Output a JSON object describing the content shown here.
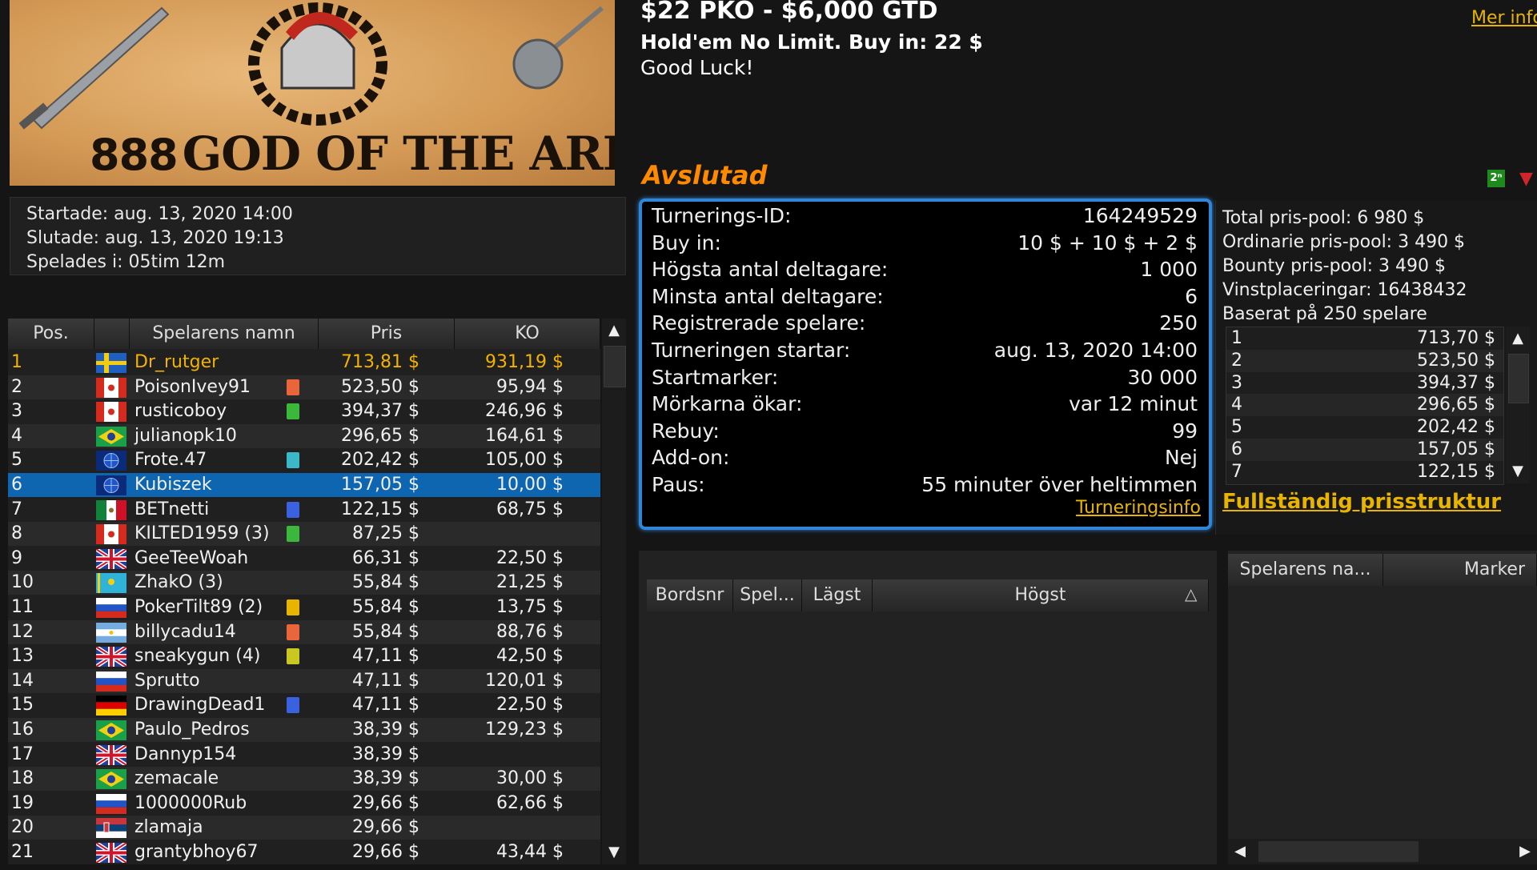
{
  "banner": {
    "logo_888": "888",
    "logo_text": "GOD OF THE ARENA"
  },
  "dates": {
    "started": "Startade: aug. 13, 2020 14:00",
    "ended": "Slutade: aug. 13, 2020 19:13",
    "played": "Spelades i: 05tim 12m"
  },
  "header": {
    "title": "$22 PKO - $6,000 GTD",
    "subtitle": "Hold'em No Limit. Buy in: 22 $",
    "greeting": "Good Luck!",
    "more_info": "Mer info",
    "status": "Avslutad",
    "badge_2n": "2ⁿ"
  },
  "players_table": {
    "columns": [
      "Pos.",
      "",
      "Spelarens namn",
      "Pris",
      "KO"
    ],
    "rows": [
      {
        "pos": "1",
        "flag": "sweden",
        "name": "Dr_rutger",
        "note": "",
        "prize": "713,81 $",
        "ko": "931,19 $"
      },
      {
        "pos": "2",
        "flag": "canada",
        "name": "PoisonIvey91",
        "note": "#e8663a",
        "prize": "523,50 $",
        "ko": "95,94 $"
      },
      {
        "pos": "3",
        "flag": "canada",
        "name": "rusticoboy",
        "note": "#3bb83b",
        "prize": "394,37 $",
        "ko": "246,96 $"
      },
      {
        "pos": "4",
        "flag": "brazil",
        "name": "julianopk10",
        "note": "",
        "prize": "296,65 $",
        "ko": "164,61 $"
      },
      {
        "pos": "5",
        "flag": "globe",
        "name": "Frote.47",
        "note": "#3ab8c8",
        "prize": "202,42 $",
        "ko": "105,00 $"
      },
      {
        "pos": "6",
        "flag": "globe",
        "name": "Kubiszek",
        "note": "",
        "prize": "157,05 $",
        "ko": "10,00 $"
      },
      {
        "pos": "7",
        "flag": "mexico",
        "name": "BETnetti",
        "note": "#3a62e0",
        "prize": "122,15 $",
        "ko": "68,75 $"
      },
      {
        "pos": "8",
        "flag": "canada",
        "name": "KILTED1959 (3)",
        "note": "#3bb83b",
        "prize": "87,25 $",
        "ko": ""
      },
      {
        "pos": "9",
        "flag": "uk",
        "name": "GeeTeeWoah",
        "note": "",
        "prize": "66,31 $",
        "ko": "22,50 $"
      },
      {
        "pos": "10",
        "flag": "kazakhstan",
        "name": "ZhakO (3)",
        "note": "",
        "prize": "55,84 $",
        "ko": "21,25 $"
      },
      {
        "pos": "11",
        "flag": "russia",
        "name": "PokerTilt89 (2)",
        "note": "#e8b400",
        "prize": "55,84 $",
        "ko": "13,75 $"
      },
      {
        "pos": "12",
        "flag": "argentina",
        "name": "billycadu14",
        "note": "#e8663a",
        "prize": "55,84 $",
        "ko": "88,76 $"
      },
      {
        "pos": "13",
        "flag": "uk",
        "name": "sneakygun (4)",
        "note": "#c8c820",
        "prize": "47,11 $",
        "ko": "42,50 $"
      },
      {
        "pos": "14",
        "flag": "russia",
        "name": "Sprutto",
        "note": "",
        "prize": "47,11 $",
        "ko": "120,01 $"
      },
      {
        "pos": "15",
        "flag": "germany",
        "name": "DrawingDead1",
        "note": "#3a62e0",
        "prize": "47,11 $",
        "ko": "22,50 $"
      },
      {
        "pos": "16",
        "flag": "brazil",
        "name": "Paulo_Pedros",
        "note": "",
        "prize": "38,39 $",
        "ko": "129,23 $"
      },
      {
        "pos": "17",
        "flag": "uk",
        "name": "Dannyp154",
        "note": "",
        "prize": "38,39 $",
        "ko": ""
      },
      {
        "pos": "18",
        "flag": "brazil",
        "name": "zemacale",
        "note": "",
        "prize": "38,39 $",
        "ko": "30,00 $"
      },
      {
        "pos": "19",
        "flag": "russia",
        "name": "1000000Rub",
        "note": "",
        "prize": "29,66 $",
        "ko": "62,66 $"
      },
      {
        "pos": "20",
        "flag": "serbia",
        "name": "zlamaja",
        "note": "",
        "prize": "29,66 $",
        "ko": ""
      },
      {
        "pos": "21",
        "flag": "uk",
        "name": "grantybhoy67",
        "note": "",
        "prize": "29,66 $",
        "ko": "43,44 $"
      }
    ],
    "selected_row": "6"
  },
  "tournament_info": {
    "rows": [
      {
        "label": "Turnerings-ID:",
        "value": "164249529"
      },
      {
        "label": "Buy in:",
        "value": "10 $ + 10 $ + 2 $"
      },
      {
        "label": "Högsta antal deltagare:",
        "value": "1 000"
      },
      {
        "label": "Minsta antal deltagare:",
        "value": "6"
      },
      {
        "label": "Registrerade spelare:",
        "value": "250"
      },
      {
        "label": "Turneringen startar:",
        "value": "aug. 13, 2020 14:00"
      },
      {
        "label": "Startmarker:",
        "value": "30 000"
      },
      {
        "label": "Mörkarna ökar:",
        "value": "var 12 minut"
      },
      {
        "label": "Rebuy:",
        "value": "99"
      },
      {
        "label": "Add-on:",
        "value": "Nej"
      },
      {
        "label": "Paus:",
        "value": "55 minuter över heltimmen"
      }
    ],
    "link": "Turneringsinfo"
  },
  "prize_pool": {
    "total": "Total pris-pool: 6 980 $",
    "ordinary": "Ordinarie pris-pool: 3 490 $",
    "bounty": "Bounty pris-pool: 3 490 $",
    "placings": "Vinstplaceringar: 16438432",
    "based_on": "Baserat på 250 spelare",
    "list": [
      {
        "place": "1",
        "amount": "713,70 $"
      },
      {
        "place": "2",
        "amount": "523,50 $"
      },
      {
        "place": "3",
        "amount": "394,37 $"
      },
      {
        "place": "4",
        "amount": "296,65 $"
      },
      {
        "place": "5",
        "amount": "202,42 $"
      },
      {
        "place": "6",
        "amount": "157,05 $"
      },
      {
        "place": "7",
        "amount": "122,15 $"
      }
    ],
    "full_structure_link": "Fullständig prisstruktur"
  },
  "tables_panel": {
    "columns": [
      "Bordsnr",
      "Spel...",
      "Lägst",
      "Högst"
    ]
  },
  "table_players_panel": {
    "columns": [
      "Spelarens na...",
      "Marker"
    ]
  }
}
